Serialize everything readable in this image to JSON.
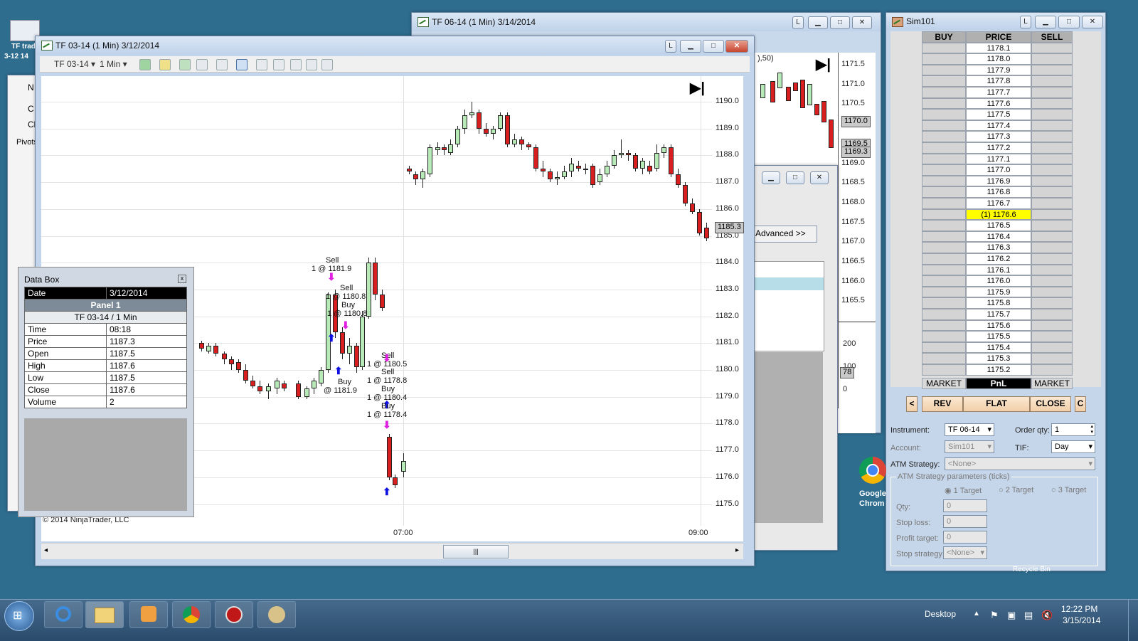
{
  "desktop": {
    "icon_label_1": "TF trad",
    "icon_label_2": "3-12 14",
    "chrome_label_1": "Google",
    "chrome_label_2": "Chrom",
    "recycle_label": "Recycle Bin"
  },
  "back_window_1": {
    "label_n": "N",
    "label_c": "C",
    "label_cl": "Cl",
    "label_pivots": "Pivots"
  },
  "tf0614_window": {
    "title": "TF 06-14 (1 Min)  3/14/2014",
    "indicator_label": "),50)",
    "price_ticks": [
      "1171.5",
      "1171.0",
      "1170.5",
      "1170.0",
      "1169.5",
      "1169.0",
      "1168.5",
      "1168.0",
      "1167.5",
      "1167.0",
      "1166.5",
      "1166.0",
      "1165.5"
    ],
    "tag_1": "1170.0",
    "tag_2": "1169.5",
    "tag_3": "1169.3",
    "volume_ticks": [
      "200",
      "100",
      "0"
    ],
    "volume_tag": "78"
  },
  "order_window": {
    "advanced_button": "Advanced >>"
  },
  "tf0314_window": {
    "title": "TF 03-14 (1 Min)  3/12/2014",
    "instrument": "TF 03-14",
    "interval": "1 Min",
    "price_ticks": [
      "1190.0",
      "1189.0",
      "1188.0",
      "1187.0",
      "1186.0",
      "1185.0",
      "1184.0",
      "1183.0",
      "1182.0",
      "1181.0",
      "1180.0",
      "1179.0",
      "1178.0",
      "1177.0",
      "1176.0",
      "1175.0"
    ],
    "current_price_tag": "1185.3",
    "time_ticks": [
      "07:00",
      "09:00"
    ],
    "copyright": "© 2014 NinjaTrader, LLC",
    "trades": [
      {
        "side": "Sell",
        "text": "1 @ 1181.9"
      },
      {
        "side": "Sell",
        "text": "1 @ 1180.8"
      },
      {
        "side": "Buy",
        "text": "1 @ 1180.8"
      },
      {
        "side": "Buy",
        "text": "@ 1181.9"
      },
      {
        "side": "Sell",
        "text": "1 @ 1180.5"
      },
      {
        "side": "Sell",
        "text": "1 @ 1178.8"
      },
      {
        "side": "Buy",
        "text": "1 @ 1180.4"
      },
      {
        "side": "Buy",
        "text": "1 @ 1178.4"
      }
    ]
  },
  "data_box": {
    "title": "Data Box",
    "date_label": "Date",
    "date_value": "3/12/2014",
    "panel": "Panel 1",
    "series": "TF 03-14 / 1 Min",
    "rows": [
      {
        "label": "Time",
        "value": "08:18"
      },
      {
        "label": "Price",
        "value": "1187.3"
      },
      {
        "label": "Open",
        "value": "1187.5"
      },
      {
        "label": "High",
        "value": "1187.6"
      },
      {
        "label": "Low",
        "value": "1187.5"
      },
      {
        "label": "Close",
        "value": "1187.6"
      },
      {
        "label": "Volume",
        "value": "2"
      }
    ]
  },
  "sim101": {
    "title": "Sim101",
    "col_buy": "BUY",
    "col_price": "PRICE",
    "col_sell": "SELL",
    "prices": [
      "1178.1",
      "1178.0",
      "1177.9",
      "1177.8",
      "1177.7",
      "1177.6",
      "1177.5",
      "1177.4",
      "1177.3",
      "1177.2",
      "1177.1",
      "1177.0",
      "1176.9",
      "1176.8",
      "1176.7",
      "(1) 1176.6",
      "1176.5",
      "1176.4",
      "1176.3",
      "1176.2",
      "1176.1",
      "1176.0",
      "1175.9",
      "1175.8",
      "1175.7",
      "1175.6",
      "1175.5",
      "1175.4",
      "1175.3",
      "1175.2"
    ],
    "position_row": 15,
    "market_left": "MARKET",
    "pnl": "PnL",
    "market_right": "MARKET",
    "btn_prev": "<",
    "btn_rev": "REV",
    "btn_flat": "FLAT",
    "btn_close": "CLOSE",
    "btn_c": "C",
    "instrument_label": "Instrument:",
    "instrument_value": "TF 06-14",
    "order_qty_label": "Order qty:",
    "order_qty_value": "1",
    "account_label": "Account:",
    "account_value": "Sim101",
    "tif_label": "TIF:",
    "tif_value": "Day",
    "atm_label": "ATM Strategy:",
    "atm_value": "<None>",
    "atm_params_label": "ATM Strategy parameters (ticks)",
    "target_1": "1 Target",
    "target_2": "2 Target",
    "target_3": "3 Target",
    "qty_label": "Qty:",
    "qty_value": "0",
    "stop_loss_label": "Stop loss:",
    "stop_loss_value": "0",
    "profit_target_label": "Profit target:",
    "profit_target_value": "0",
    "stop_strategy_label": "Stop strategy:",
    "stop_strategy_value": "<None>"
  },
  "taskbar": {
    "desktop_label": "Desktop",
    "time": "12:22 PM",
    "date": "3/15/2014"
  },
  "colors": {
    "up_candle": "#b8eab8",
    "down_candle": "#d81e1e",
    "sell_arrow": "#e020e0",
    "buy_arrow": "#1010e0",
    "position_highlight": "#ffff00",
    "pnl_bg": "#000000"
  }
}
